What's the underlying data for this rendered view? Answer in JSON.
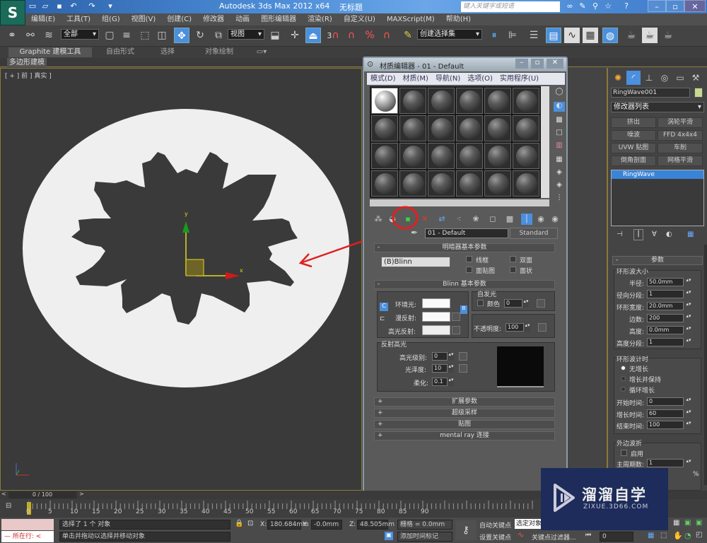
{
  "app": {
    "title": "Autodesk 3ds Max  2012 x64",
    "document": "无标题",
    "search_placeholder": "键入关键字或短语",
    "logo_glyph": "S"
  },
  "quick_access": [
    "new-file-icon",
    "open-file-icon",
    "save-icon",
    "undo-icon",
    "redo-icon",
    "customize-icon"
  ],
  "menubar": [
    "编辑(E)",
    "工具(T)",
    "组(G)",
    "视图(V)",
    "创建(C)",
    "修改器",
    "动画",
    "图形编辑器",
    "渲染(R)",
    "自定义(U)",
    "MAXScript(M)",
    "帮助(H)"
  ],
  "toolbar": {
    "selection_filter": "全部",
    "reference_coord": "视图",
    "snap_label": "3",
    "named_selection": "创建选择集"
  },
  "ribbon": {
    "tabs": [
      "Graphite 建模工具",
      "自由形式",
      "选择",
      "对象绘制"
    ],
    "sub_tab": "多边形建模"
  },
  "viewport": {
    "label": "[ + ] 前 ] 真实 ]",
    "axis_x": "x",
    "axis_y": "y"
  },
  "material_editor": {
    "title": "材质编辑器 - 01 - Default",
    "menu": [
      "模式(D)",
      "材质(M)",
      "导航(N)",
      "选项(O)",
      "实用程序(U)"
    ],
    "slot_rows": 4,
    "slot_cols": 6,
    "selected_slot": 0,
    "material_name": "01 - Default",
    "material_type": "Standard",
    "shader_rollout": "明暗器基本参数",
    "shader": "(B)Blinn",
    "shader_options": [
      "线框",
      "双面",
      "面贴图",
      "面状"
    ],
    "blinn_rollout": "Blinn 基本参数",
    "ambient_label": "环境光:",
    "diffuse_label": "漫反射:",
    "specular_label": "高光反射:",
    "self_illum_group": "自发光",
    "self_illum_color_label": "颜色",
    "self_illum_value": "0",
    "opacity_label": "不透明度:",
    "opacity_value": "100",
    "spec_group": "反射高光",
    "spec_level_label": "高光级别:",
    "spec_level": "0",
    "gloss_label": "光泽度:",
    "gloss": "10",
    "soften_label": "柔化:",
    "soften": "0.1",
    "collapsed_rollouts": [
      "扩展参数",
      "超级采样",
      "贴图",
      "mental ray 连接"
    ],
    "rollout_minus": "-",
    "rollout_plus": "+"
  },
  "command_panel": {
    "object_name": "RingWave001",
    "object_color": "#c8d890",
    "modifier_list": "修改器列表",
    "modifier_buttons": [
      "挤出",
      "涡轮平滑",
      "噪波",
      "FFD 4x4x4",
      "UVW 贴图",
      "车削",
      "倒角剖面",
      "网格平滑"
    ],
    "stack": [
      "RingWave"
    ],
    "params_rollout": "参数",
    "size_group": "环形波大小",
    "size_fields": [
      {
        "label": "半径:",
        "value": "50.0mm"
      },
      {
        "label": "径向分段:",
        "value": "1"
      },
      {
        "label": "环形宽度:",
        "value": "20.0mm"
      },
      {
        "label": "边数:",
        "value": "200"
      },
      {
        "label": "高度:",
        "value": "0.0mm"
      },
      {
        "label": "高度分段:",
        "value": "1"
      }
    ],
    "timing_group": "环形波计时",
    "timing_options": [
      "无增长",
      "增长并保持",
      "循环增长"
    ],
    "timing_selected": 0,
    "timing_fields": [
      {
        "label": "开始时间:",
        "value": "0"
      },
      {
        "label": "增长时间:",
        "value": "60"
      },
      {
        "label": "结束时间:",
        "value": "100"
      }
    ],
    "outer_group": "外边波折",
    "outer_enable": "启用",
    "outer_field_label": "主周期数:",
    "outer_field_value": "1",
    "percent": "%"
  },
  "timeline": {
    "frame": "0 / 100",
    "ticks": [
      "0",
      "5",
      "10",
      "15",
      "20",
      "25",
      "30",
      "35",
      "40",
      "45",
      "50",
      "55",
      "60",
      "65",
      "70",
      "75",
      "80",
      "85",
      "90"
    ],
    "prev": "<",
    "next": ">"
  },
  "status": {
    "script_label": "所在行:",
    "selection_msg": "选择了 1 个 对象",
    "prompt": "单击并拖动以选择并移动对象",
    "x_label": "X:",
    "x": "180.684mm",
    "y_label": "Y:",
    "y": "-0.0mm",
    "z_label": "Z:",
    "z": "48.505mm",
    "grid": "栅格 = 0.0mm",
    "add_time_tag": "添加时间标记",
    "auto_key": "自动关键点",
    "set_key": "设置关键点",
    "key_mode": "选定对象",
    "key_filters": "关键点过滤器...",
    "current_frame": "0"
  },
  "watermark": {
    "title": "溜溜自学",
    "url": "ZIXUE.3D66.COM"
  },
  "annotation": {
    "color": "#e02020"
  }
}
